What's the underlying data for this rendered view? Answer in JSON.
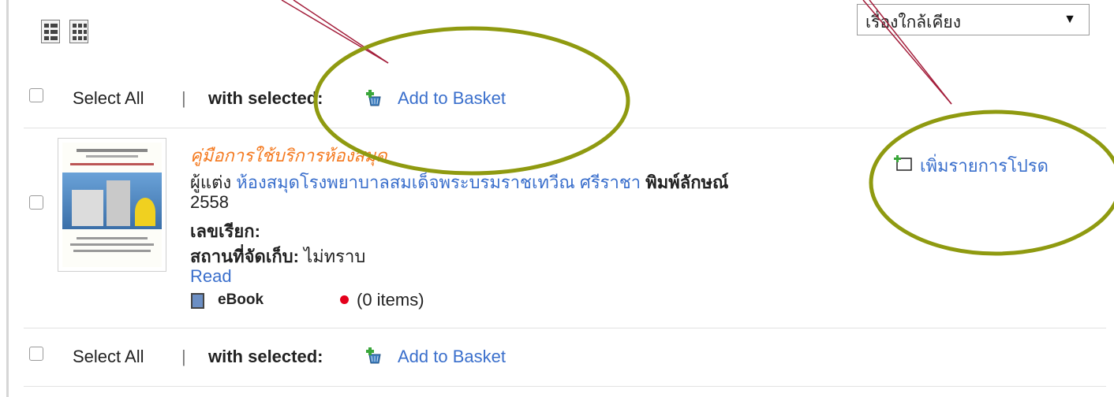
{
  "toolbar": {
    "sort_selected": "เรื่องใกล้เคียง",
    "sort_arrow": "▼"
  },
  "bulk_top": {
    "select_all": "Select All",
    "divider": "|",
    "with_selected": "with selected:",
    "add_to_basket": "Add to Basket"
  },
  "bulk_bottom": {
    "select_all": "Select All",
    "divider": "|",
    "with_selected": "with selected:",
    "add_to_basket": "Add to Basket"
  },
  "result": {
    "title": "คู่มือการใช้บริการห้องสมุด",
    "author_label": "ผู้แต่ง",
    "author": "ห้องสมุดโรงพยาบาลสมเด็จพระบรมราชเทวีณ ศรีราชา",
    "published_label": "พิมพ์ลักษณ์",
    "year": "2558",
    "call_number_label": "เลขเรียก:",
    "location_label": "สถานที่จัดเก็บ:",
    "location_value": "ไม่ทราบ",
    "read_link": "Read",
    "format": "eBook",
    "items_count": "(0 items)",
    "add_to_favorites": "เพิ่มรายการโปรด"
  },
  "colors": {
    "title": "#f47a20",
    "link": "#3a6fcc",
    "annotation": "#8f9a10",
    "arrow": "#a31d3a",
    "availability": "#e4001b"
  }
}
